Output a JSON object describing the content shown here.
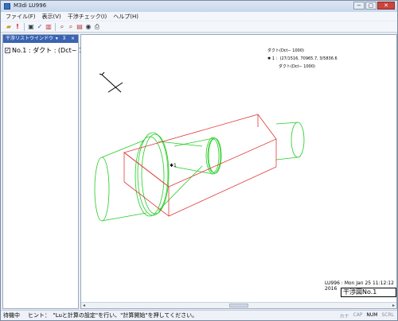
{
  "window": {
    "title": "M3di LU996"
  },
  "menu": [
    "ファイル(F)",
    "表示(V)",
    "干渉チェック(I)",
    "ヘルプ(H)"
  ],
  "toolbar_icons": [
    "open-icon",
    "warning-icon",
    "save-icon",
    "check-icon",
    "chart-icon",
    "zoom-in-icon",
    "zoom-out-icon",
    "fit-icon",
    "eye-icon",
    "print-icon"
  ],
  "panel": {
    "title": "干渉リストウインドウ",
    "controls": "▾ ⊼ ×",
    "item_label": "No.1 : ダクト : (Dct− 1000)"
  },
  "view": {
    "annotation_1": "ダクト(Dct− 1000)",
    "annotation_2": "✱ 1 ：(27/1516, 70965.7, 3/5836.6",
    "annotation_3": "ダクト(Dct− 1000)",
    "marker": "✱1",
    "datestamp": "LU996 : Mon Jan 25 11:12:12 2016",
    "plane_label": "干渉図No.1"
  },
  "status": {
    "mode": "待機中",
    "hint": "ヒント：　\"Luと計算の設定\"を行い、\"計算開始\"を押してください。",
    "indicators": [
      "カナ",
      "CAP",
      "NUM",
      "SCRL"
    ]
  },
  "colors": {
    "duct_green": "#22cc22",
    "duct_red": "#e23a3a",
    "panel_header": "#3b63b3"
  }
}
